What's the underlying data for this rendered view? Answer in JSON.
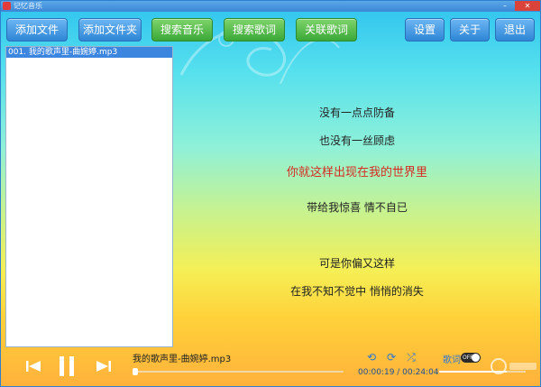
{
  "window": {
    "title": "记忆音乐"
  },
  "toolbar": {
    "add_file": "添加文件",
    "add_folder": "添加文件夹",
    "search_music": "搜索音乐",
    "search_lyrics": "搜索歌词",
    "link_lyrics": "关联歌词",
    "settings": "设置",
    "about": "关于",
    "exit": "退出"
  },
  "playlist": {
    "items": [
      {
        "label": "001. 我的歌声里-曲婉婷.mp3",
        "selected": true
      }
    ]
  },
  "lyrics": {
    "lines": [
      "没有一点点防备",
      "也没有一丝顾虑",
      "你就这样出现在我的世界里",
      "带给我惊喜 情不自已",
      "可是你偏又这样",
      "在我不知不觉中 悄悄的消失"
    ],
    "active_index": 2
  },
  "player": {
    "song": "我的歌声里-曲婉婷.mp3",
    "time": "00:00:19 / 00:24:04",
    "progress": 0.013,
    "volume": 0.78,
    "lyrics_label": "歌词",
    "lyrics_switch": "OFF"
  },
  "icons": {
    "prev": "prev-icon",
    "pause": "pause-icon",
    "next": "next-icon",
    "repeat": "repeat-icon",
    "loop": "loop-icon",
    "shuffle": "shuffle-icon"
  },
  "colors": {
    "accent_blue": "#2f86d6",
    "accent_green": "#3aa838",
    "active_lyric": "#d62a22"
  }
}
